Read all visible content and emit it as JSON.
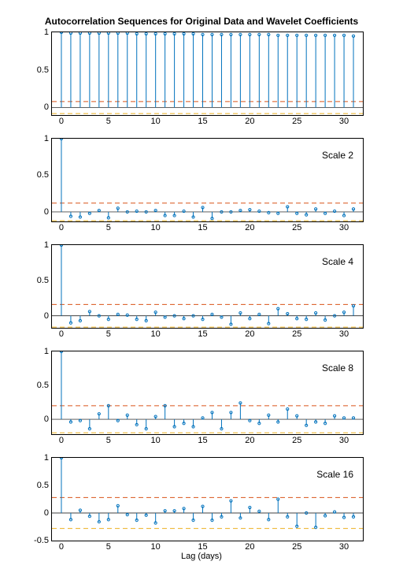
{
  "title": "Autocorrelation Sequences for Original Data and Wavelet Coefficients",
  "xlabel": "Lag (days)",
  "chart_data": [
    {
      "type": "stem",
      "label": "",
      "x": [
        0,
        1,
        2,
        3,
        4,
        5,
        6,
        7,
        8,
        9,
        10,
        11,
        12,
        13,
        14,
        15,
        16,
        17,
        18,
        19,
        20,
        21,
        22,
        23,
        24,
        25,
        26,
        27,
        28,
        29,
        30,
        31
      ],
      "values": [
        1.0,
        0.99,
        0.99,
        0.99,
        0.99,
        0.99,
        0.99,
        0.99,
        0.98,
        0.98,
        0.98,
        0.98,
        0.98,
        0.98,
        0.98,
        0.97,
        0.97,
        0.97,
        0.97,
        0.97,
        0.97,
        0.97,
        0.97,
        0.96,
        0.96,
        0.96,
        0.96,
        0.96,
        0.96,
        0.96,
        0.96,
        0.95
      ],
      "conf_upper": 0.08,
      "conf_lower": -0.08,
      "ylim": [
        -0.1,
        1.0
      ],
      "yticks": [
        0,
        0.5,
        1
      ],
      "xticks": [
        0,
        5,
        10,
        15,
        20,
        25,
        30
      ],
      "xlim": [
        -1,
        32
      ]
    },
    {
      "type": "stem",
      "label": "Scale 2",
      "x": [
        0,
        1,
        2,
        3,
        4,
        5,
        6,
        7,
        8,
        9,
        10,
        11,
        12,
        13,
        14,
        15,
        16,
        17,
        18,
        19,
        20,
        21,
        22,
        23,
        24,
        25,
        26,
        27,
        28,
        29,
        30,
        31
      ],
      "values": [
        1.0,
        -0.06,
        -0.07,
        -0.02,
        0.02,
        -0.08,
        0.05,
        0.0,
        0.01,
        0.0,
        0.02,
        -0.05,
        -0.05,
        0.01,
        -0.07,
        0.06,
        -0.09,
        0.0,
        0.0,
        0.02,
        0.03,
        0.01,
        -0.01,
        -0.02,
        0.07,
        -0.02,
        -0.04,
        0.04,
        -0.02,
        0.01,
        -0.05,
        0.04
      ],
      "conf_upper": 0.12,
      "conf_lower": -0.12,
      "ylim": [
        -0.13,
        1.0
      ],
      "yticks": [
        0,
        0.5,
        1
      ],
      "xticks": [
        0,
        5,
        10,
        15,
        20,
        25,
        30
      ],
      "xlim": [
        -1,
        32
      ]
    },
    {
      "type": "stem",
      "label": "Scale 4",
      "x": [
        0,
        1,
        2,
        3,
        4,
        5,
        6,
        7,
        8,
        9,
        10,
        11,
        12,
        13,
        14,
        15,
        16,
        17,
        18,
        19,
        20,
        21,
        22,
        23,
        24,
        25,
        26,
        27,
        28,
        29,
        30,
        31
      ],
      "values": [
        1.0,
        -0.1,
        -0.07,
        0.06,
        0.0,
        -0.05,
        0.02,
        0.01,
        -0.05,
        -0.07,
        0.05,
        -0.02,
        0.0,
        -0.04,
        0.0,
        -0.05,
        0.02,
        -0.02,
        -0.12,
        0.04,
        -0.04,
        0.02,
        -0.11,
        0.1,
        0.03,
        -0.04,
        -0.05,
        0.04,
        -0.06,
        0.0,
        0.05,
        0.14
      ],
      "conf_upper": 0.16,
      "conf_lower": -0.16,
      "ylim": [
        -0.17,
        1.0
      ],
      "yticks": [
        0,
        0.5,
        1
      ],
      "xticks": [
        0,
        5,
        10,
        15,
        20,
        25,
        30
      ],
      "xlim": [
        -1,
        32
      ]
    },
    {
      "type": "stem",
      "label": "Scale 8",
      "x": [
        0,
        1,
        2,
        3,
        4,
        5,
        6,
        7,
        8,
        9,
        10,
        11,
        12,
        13,
        14,
        15,
        16,
        17,
        18,
        19,
        20,
        21,
        22,
        23,
        24,
        25,
        26,
        27,
        28,
        29,
        30,
        31
      ],
      "values": [
        1.0,
        -0.04,
        -0.02,
        -0.14,
        0.08,
        0.2,
        -0.02,
        0.06,
        -0.08,
        -0.14,
        0.04,
        0.2,
        -0.11,
        -0.06,
        -0.11,
        0.02,
        0.1,
        -0.14,
        0.1,
        0.24,
        -0.02,
        -0.06,
        0.06,
        -0.04,
        0.15,
        0.05,
        -0.09,
        -0.04,
        -0.06,
        0.05,
        0.02,
        0.02
      ],
      "conf_upper": 0.2,
      "conf_lower": -0.2,
      "ylim": [
        -0.22,
        1.0
      ],
      "yticks": [
        0,
        0.5,
        1
      ],
      "xticks": [
        0,
        5,
        10,
        15,
        20,
        25,
        30
      ],
      "xlim": [
        -1,
        32
      ]
    },
    {
      "type": "stem",
      "label": "Scale 16",
      "x": [
        0,
        1,
        2,
        3,
        4,
        5,
        6,
        7,
        8,
        9,
        10,
        11,
        12,
        13,
        14,
        15,
        16,
        17,
        18,
        19,
        20,
        21,
        22,
        23,
        24,
        25,
        26,
        27,
        28,
        29,
        30,
        31
      ],
      "values": [
        1.0,
        -0.12,
        0.05,
        -0.06,
        -0.16,
        -0.12,
        0.13,
        -0.03,
        -0.13,
        -0.04,
        -0.18,
        0.04,
        0.04,
        0.08,
        -0.13,
        0.12,
        -0.13,
        -0.07,
        0.22,
        -0.09,
        0.1,
        0.03,
        -0.12,
        0.25,
        -0.07,
        -0.24,
        0.0,
        -0.26,
        -0.05,
        0.02,
        -0.08,
        -0.07
      ],
      "conf_upper": 0.28,
      "conf_lower": -0.28,
      "ylim": [
        -0.5,
        1.0
      ],
      "yticks": [
        -0.5,
        0,
        0.5,
        1
      ],
      "xticks": [
        0,
        5,
        10,
        15,
        20,
        25,
        30
      ],
      "xlim": [
        -1,
        32
      ]
    }
  ]
}
